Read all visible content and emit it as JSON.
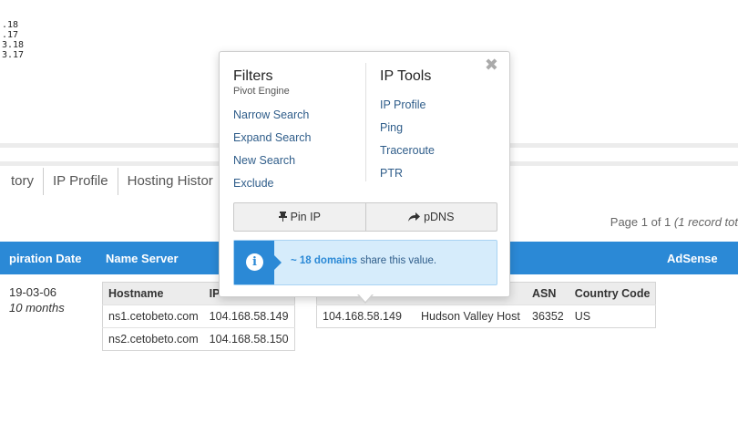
{
  "ip_list": [
    ".18",
    ".17",
    "3.18",
    "3.17"
  ],
  "tabs": [
    "tory",
    "IP Profile",
    "Hosting Histor"
  ],
  "pager": {
    "text": "Page 1 of 1 ",
    "italic": "(1 record tot"
  },
  "header": {
    "expiration_date": "piration Date",
    "name_server": "Name Server",
    "adsense": "AdSense"
  },
  "expiration": {
    "date": "19-03-06",
    "relative": "10 months"
  },
  "ns_table": {
    "headers": [
      "Hostname",
      "IP"
    ],
    "rows": [
      {
        "hostname": "ns1.cetobeto.com",
        "ip": "104.168.58.149"
      },
      {
        "hostname": "ns2.cetobeto.com",
        "ip": "104.168.58.150"
      }
    ]
  },
  "ip_table": {
    "headers": [
      "",
      "",
      "ASN",
      "Country Code"
    ],
    "row": {
      "ip": "104.168.58.149",
      "host": "Hudson Valley Host",
      "asn": "36352",
      "country": "US"
    }
  },
  "popup": {
    "close": "✖",
    "filters": {
      "title": "Filters",
      "subtitle": "Pivot Engine",
      "items": [
        "Narrow Search",
        "Expand Search",
        "New Search",
        "Exclude"
      ]
    },
    "ip_tools": {
      "title": "IP Tools",
      "items": [
        "IP Profile",
        "Ping",
        "Traceroute",
        "PTR"
      ]
    },
    "buttons": {
      "pin": "Pin IP",
      "pdns": "pDNS"
    },
    "info": {
      "count": "~ 18 domains",
      "suffix": " share this value."
    }
  },
  "colors": {
    "accent": "#2b89d6",
    "link_dark": "#2f5d8a",
    "info_bg": "#d6ecfb"
  }
}
